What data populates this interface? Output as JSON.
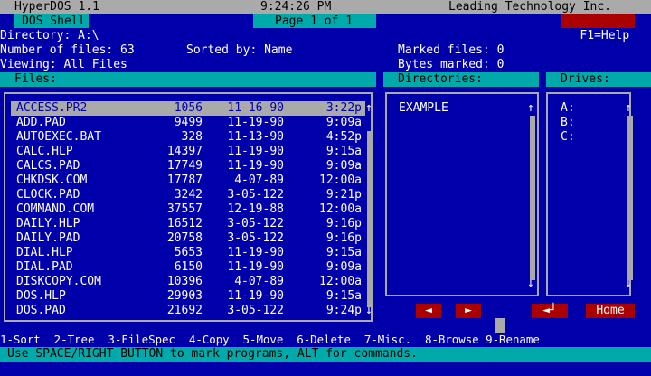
{
  "title_bar": {
    "app_name": "HyperDOS 1.1",
    "time": "9:24:26 PM",
    "company": "Leading Technology Inc."
  },
  "second_bar": {
    "shell_label": "DOS Shell",
    "page_label": "Page 1 of 1",
    "help_label": "F1=Help"
  },
  "info": {
    "directory": "Directory: A:\\",
    "number_of_files": "Number of files: 63",
    "sorted_by": "Sorted by: Name",
    "viewing": "Viewing: All Files",
    "marked_files": "Marked files: 0",
    "bytes_marked": "Bytes marked: 0"
  },
  "headers": {
    "files": "Files:",
    "directories": "Directories:",
    "drives": "Drives:"
  },
  "files": [
    {
      "name": "ACCESS.PR2",
      "size": "1056",
      "date": "11-16-90",
      "time": "3:22p",
      "selected": true
    },
    {
      "name": "ADD.PAD",
      "size": "9499",
      "date": "11-19-90",
      "time": "9:09a"
    },
    {
      "name": "AUTOEXEC.BAT",
      "size": "328",
      "date": "11-13-90",
      "time": "4:52p"
    },
    {
      "name": "CALC.HLP",
      "size": "14397",
      "date": "11-19-90",
      "time": "9:15a"
    },
    {
      "name": "CALCS.PAD",
      "size": "17749",
      "date": "11-19-90",
      "time": "9:09a"
    },
    {
      "name": "CHKDSK.COM",
      "size": "17787",
      "date": "4-07-89",
      "time": "12:00a"
    },
    {
      "name": "CLOCK.PAD",
      "size": "3242",
      "date": "3-05-122",
      "time": "9:21p"
    },
    {
      "name": "COMMAND.COM",
      "size": "37557",
      "date": "12-19-88",
      "time": "12:00a"
    },
    {
      "name": "DAILY.HLP",
      "size": "16512",
      "date": "3-05-122",
      "time": "9:16p"
    },
    {
      "name": "DAILY.PAD",
      "size": "20758",
      "date": "3-05-122",
      "time": "9:16p"
    },
    {
      "name": "DIAL.HLP",
      "size": "5653",
      "date": "11-19-90",
      "time": "9:15a"
    },
    {
      "name": "DIAL.PAD",
      "size": "6150",
      "date": "11-19-90",
      "time": "9:09a"
    },
    {
      "name": "DISKCOPY.COM",
      "size": "10396",
      "date": "4-07-89",
      "time": "12:00a"
    },
    {
      "name": "DOS.HLP",
      "size": "29903",
      "date": "11-19-90",
      "time": "9:15a"
    },
    {
      "name": "DOS.PAD",
      "size": "21692",
      "date": "3-05-122",
      "time": "9:24p"
    }
  ],
  "directories": [
    "EXAMPLE"
  ],
  "drives": [
    "A:",
    "B:",
    "C:"
  ],
  "nav_buttons": {
    "left": "◄",
    "right": "►",
    "back": "◄┘",
    "home": "Home"
  },
  "function_keys": "1-Sort  2-Tree  3-FileSpec  4-Copy  5-Move  6-Delete  7-Misc.  8-Browse 9-Rename",
  "status": "Use SPACE/RIGHT BUTTON to mark programs, ALT for commands.",
  "icons": {
    "up_arrow": "↑",
    "down_arrow": "↓"
  }
}
